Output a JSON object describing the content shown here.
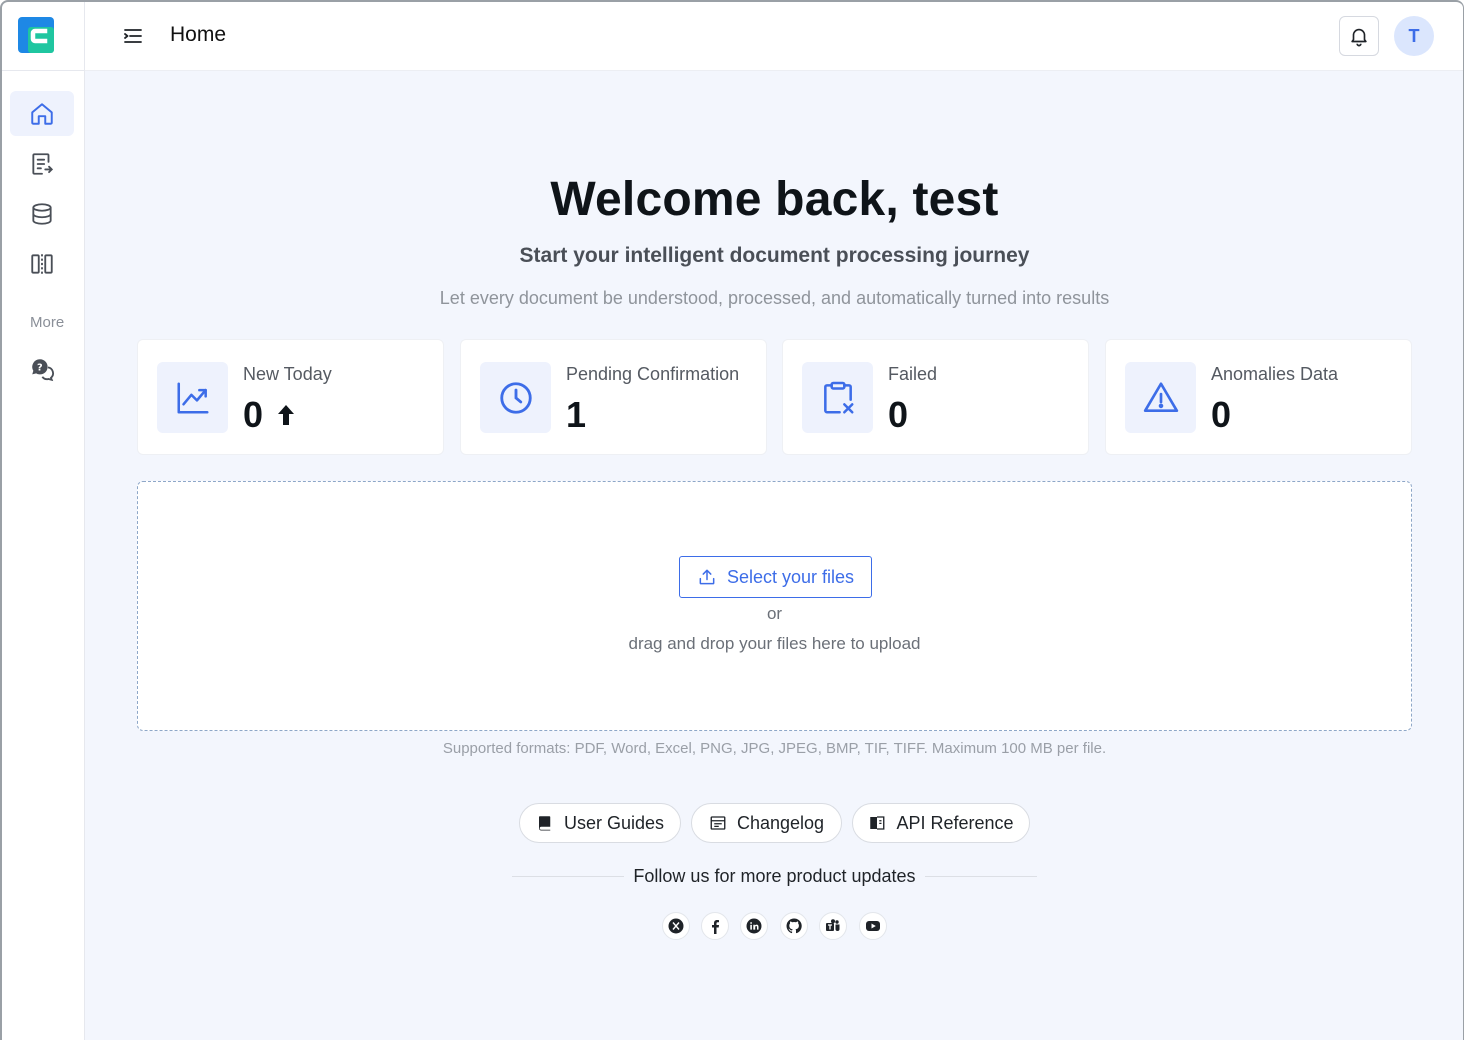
{
  "header": {
    "title": "Home",
    "avatar_initial": "T"
  },
  "sidebar": {
    "items": [
      {
        "name": "home",
        "icon": "home-icon",
        "active": true
      },
      {
        "name": "documents",
        "icon": "document-list-icon",
        "active": false
      },
      {
        "name": "database",
        "icon": "database-icon",
        "active": false
      },
      {
        "name": "compare",
        "icon": "compare-icon",
        "active": false
      }
    ],
    "more_label": "More",
    "help_icon": "help-chat-icon"
  },
  "welcome": {
    "title": "Welcome back, test",
    "subtitle": "Start your intelligent document processing journey",
    "tagline": "Let every document be understood, processed, and automatically turned into results"
  },
  "stats": [
    {
      "label": "New Today",
      "value": "0",
      "icon": "trend-chart-icon",
      "trend": "up"
    },
    {
      "label": "Pending Confirmation",
      "value": "1",
      "icon": "clock-icon"
    },
    {
      "label": "Failed",
      "value": "0",
      "icon": "clipboard-x-icon"
    },
    {
      "label": "Anomalies Data",
      "value": "0",
      "icon": "warning-triangle-icon"
    }
  ],
  "upload": {
    "button_label": "Select your files",
    "or_text": "or",
    "hint": "drag and drop your files here to upload",
    "formats": "Supported formats: PDF, Word, Excel, PNG, JPG, JPEG, BMP, TIF, TIFF. Maximum 100 MB per file."
  },
  "links": [
    {
      "label": "User Guides",
      "icon": "book-icon"
    },
    {
      "label": "Changelog",
      "icon": "changelog-icon"
    },
    {
      "label": "API Reference",
      "icon": "api-book-icon"
    }
  ],
  "follow_text": "Follow us for more product updates",
  "socials": [
    "x-icon",
    "facebook-icon",
    "linkedin-icon",
    "github-icon",
    "teams-icon",
    "youtube-icon"
  ],
  "colors": {
    "accent": "#3d6de8",
    "background": "#f3f6fd",
    "logo_blue": "#1e88e5",
    "logo_green": "#1fc6a0"
  }
}
